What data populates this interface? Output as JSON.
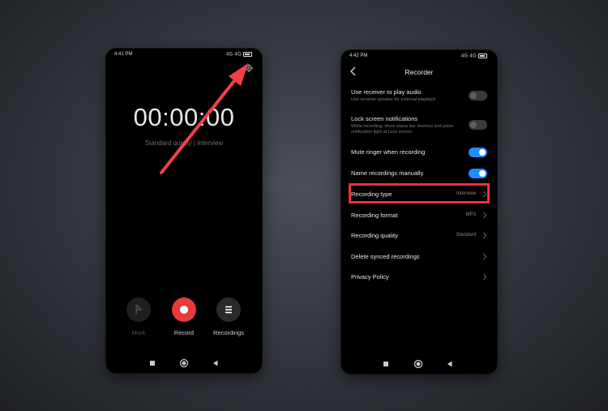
{
  "left_phone": {
    "status": {
      "time": "4:41 PM",
      "icons": "4G 4G"
    },
    "timer": "00:00:00",
    "subinfo": "Standard quality | Interview",
    "controls": [
      {
        "label": "Mark",
        "icon": "flag-icon"
      },
      {
        "label": "Record",
        "icon": "record-icon"
      },
      {
        "label": "Recordings",
        "icon": "list-icon"
      }
    ]
  },
  "right_phone": {
    "status": {
      "time": "4:42 PM",
      "icons": "4G 4G"
    },
    "title": "Recorder",
    "settings": [
      {
        "title": "Use receiver to play audio",
        "desc": "Use receiver speaker for external playback",
        "toggle": "off"
      },
      {
        "title": "Lock screen notifications",
        "desc": "While recording, show status bar shortcut and pulse notification light at Lock screen",
        "toggle": "off"
      },
      {
        "title": "Mute ringer when recording",
        "toggle": "on"
      },
      {
        "title": "Name recordings manually",
        "toggle": "on"
      },
      {
        "title": "Recording type",
        "value": "Interview"
      },
      {
        "title": "Recording format",
        "value": "MP3"
      },
      {
        "title": "Recording quality",
        "value": "Standard"
      },
      {
        "title": "Delete synced recordings"
      },
      {
        "title": "Privacy Policy"
      }
    ]
  },
  "colors": {
    "accent_red": "#e9393b",
    "toggle_blue": "#1f8cff",
    "highlight_red": "#ef2f3a"
  }
}
